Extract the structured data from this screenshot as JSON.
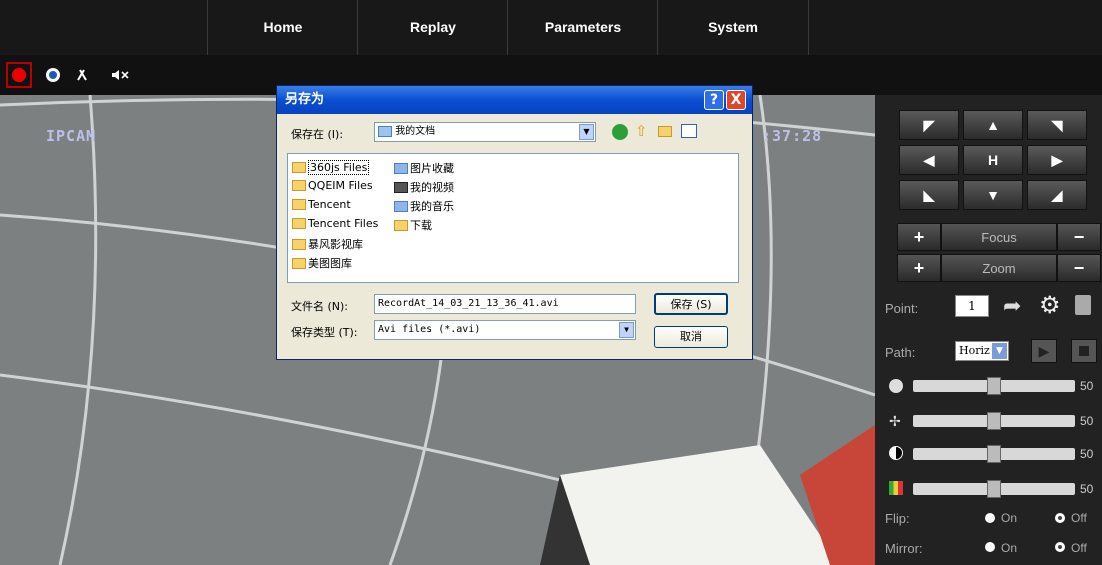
{
  "nav": {
    "home": "Home",
    "replay": "Replay",
    "parameters": "Parameters",
    "system": "System"
  },
  "video": {
    "osd_name": "IPCAM",
    "osd_time": ":37:28"
  },
  "dialog": {
    "title": "另存为",
    "save_in_label": "保存在 (I):",
    "save_in_value": "我的文档",
    "folders": [
      "360js Files",
      "QQEIM Files",
      "Tencent",
      "Tencent Files",
      "暴风影视库",
      "美图图库",
      "图片收藏",
      "我的视频",
      "我的音乐",
      "下载"
    ],
    "filename_label": "文件名 (N):",
    "filename_value": "RecordAt_14_03_21_13_36_41.avi",
    "filetype_label": "保存类型 (T):",
    "filetype_value": "Avi files (*.avi)",
    "save_button": "保存 (S)",
    "cancel_button": "取消",
    "help": "?",
    "close": "X"
  },
  "ptz": {
    "home": "H",
    "focus": "Focus",
    "zoom": "Zoom"
  },
  "panel": {
    "point_label": "Point:",
    "point_value": "1",
    "path_label": "Path:",
    "path_value": "Horiz",
    "sliders": [
      {
        "icon": "brightness-icon",
        "value": "50"
      },
      {
        "icon": "hue-icon",
        "value": "50"
      },
      {
        "icon": "contrast-icon",
        "value": "50"
      },
      {
        "icon": "saturation-icon",
        "value": "50"
      }
    ],
    "flip_label": "Flip:",
    "mirror_label": "Mirror:",
    "on": "On",
    "off": "Off"
  },
  "colors": {
    "accent": "#0a4fd2",
    "record": "#e00000"
  }
}
